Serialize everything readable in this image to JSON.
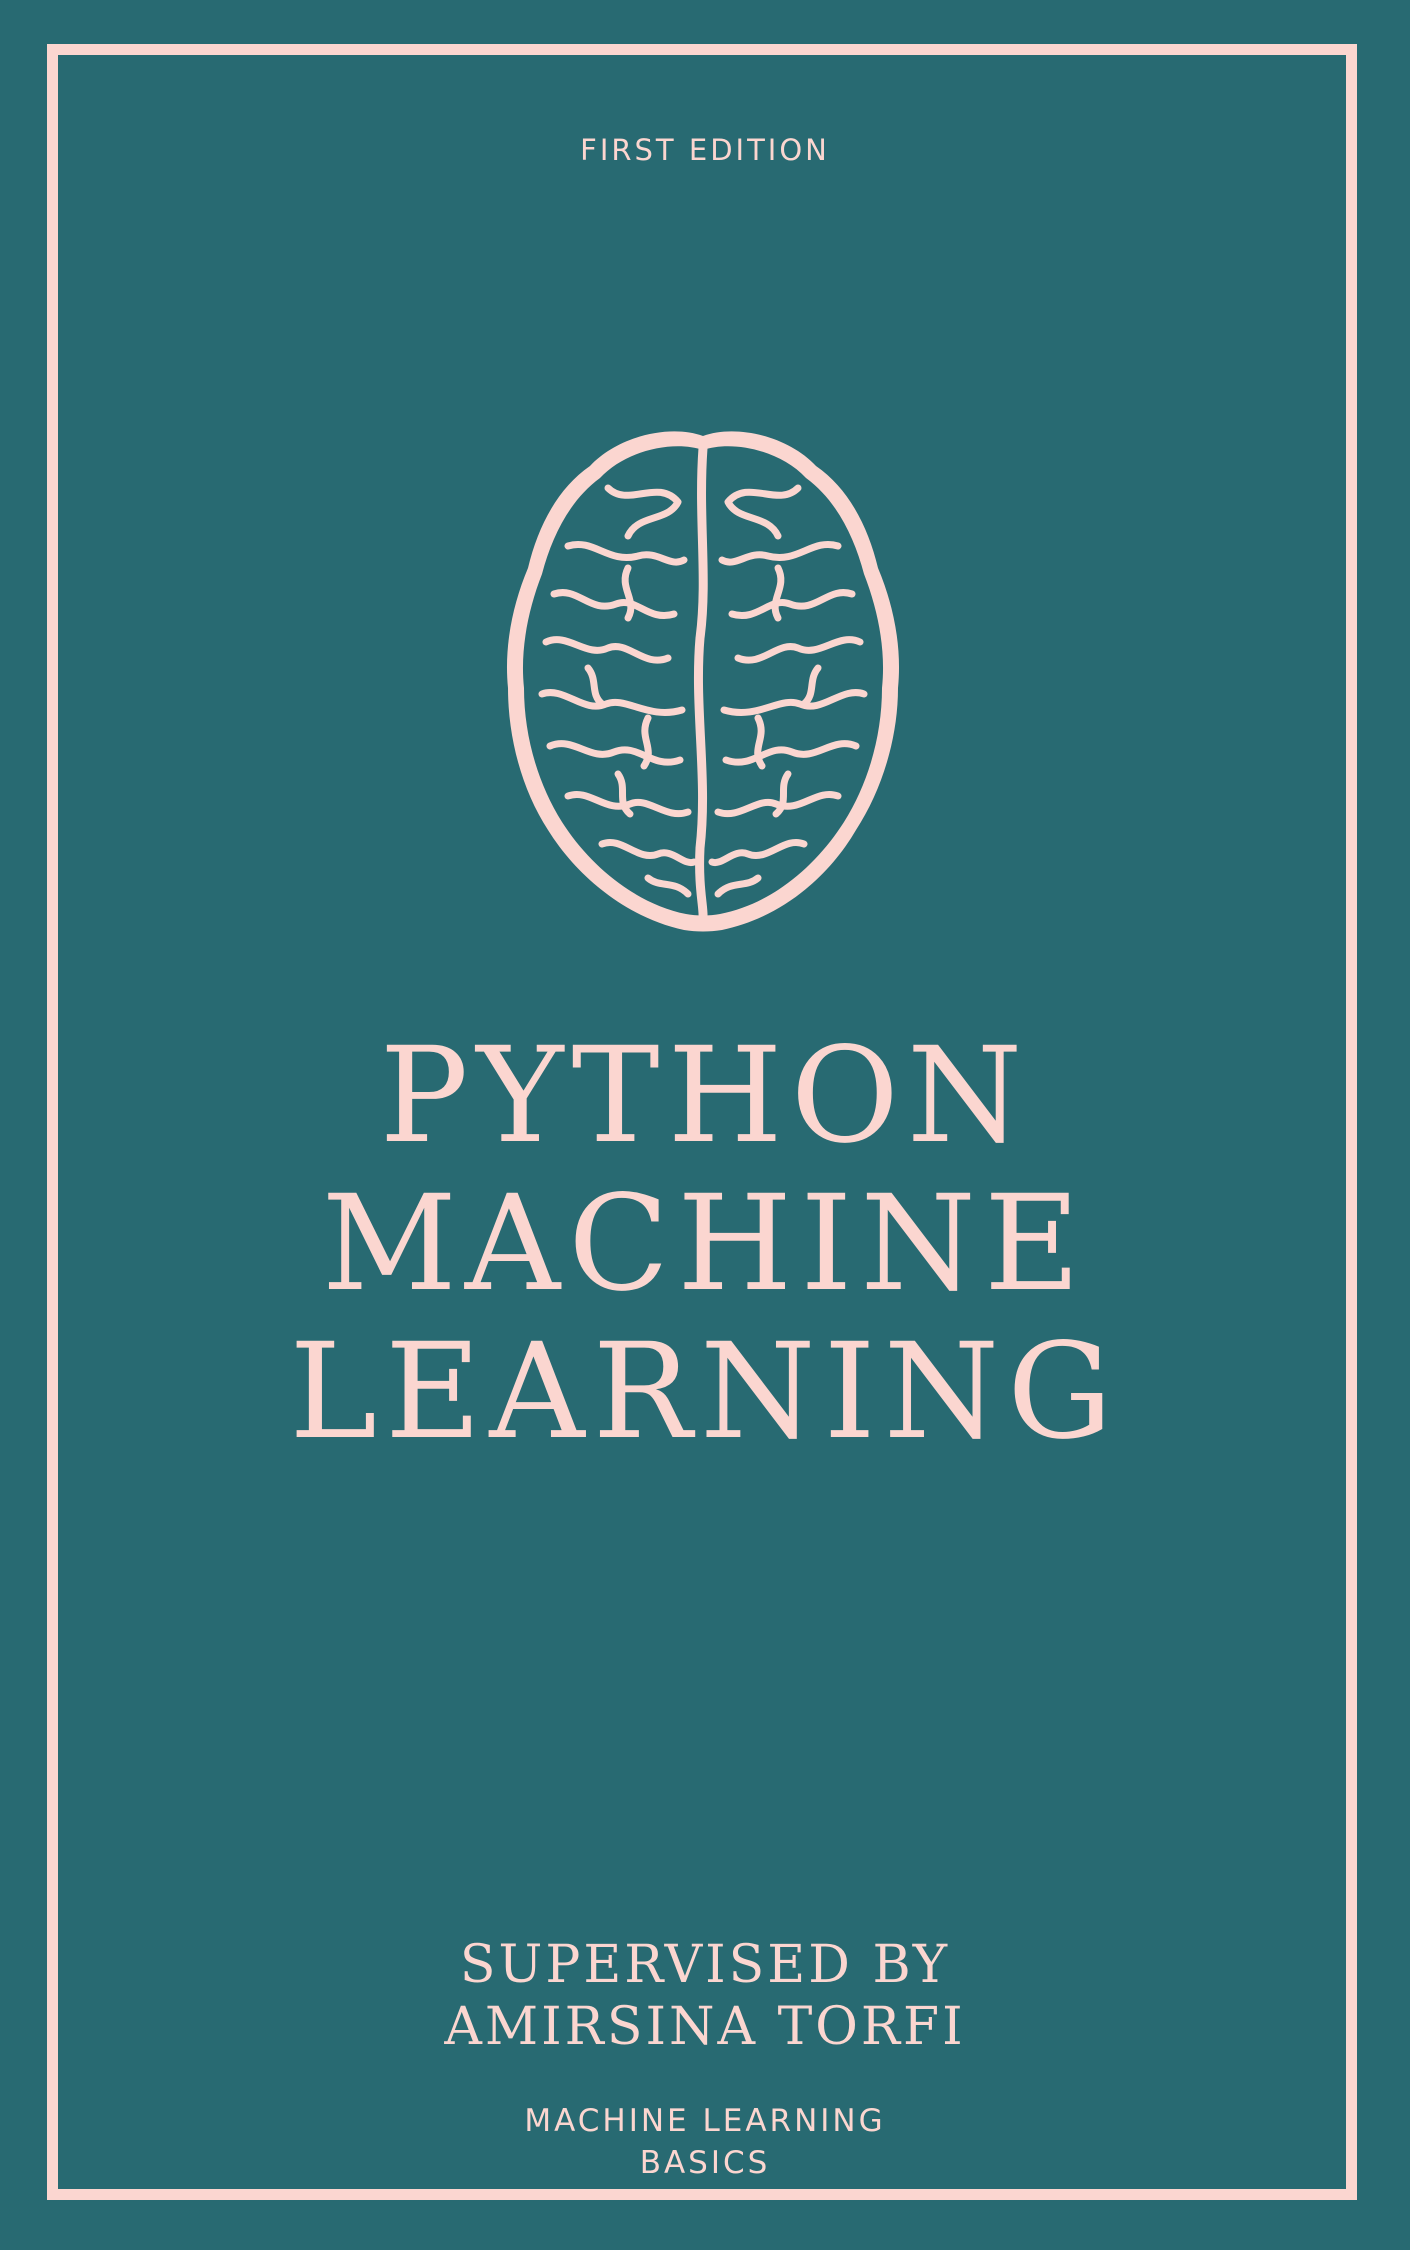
{
  "cover": {
    "edition": "FIRST EDITION",
    "title_lines": [
      "PYTHON",
      "MACHINE",
      "LEARNING"
    ],
    "supervised_line1": "SUPERVISED BY",
    "supervised_line2": "AMIRSINA TORFI",
    "series_line1": "MACHINE LEARNING",
    "series_line2": "BASICS",
    "illustration": "brain-icon"
  },
  "colors": {
    "background": "#286a72",
    "accent": "#fbd6d0"
  }
}
